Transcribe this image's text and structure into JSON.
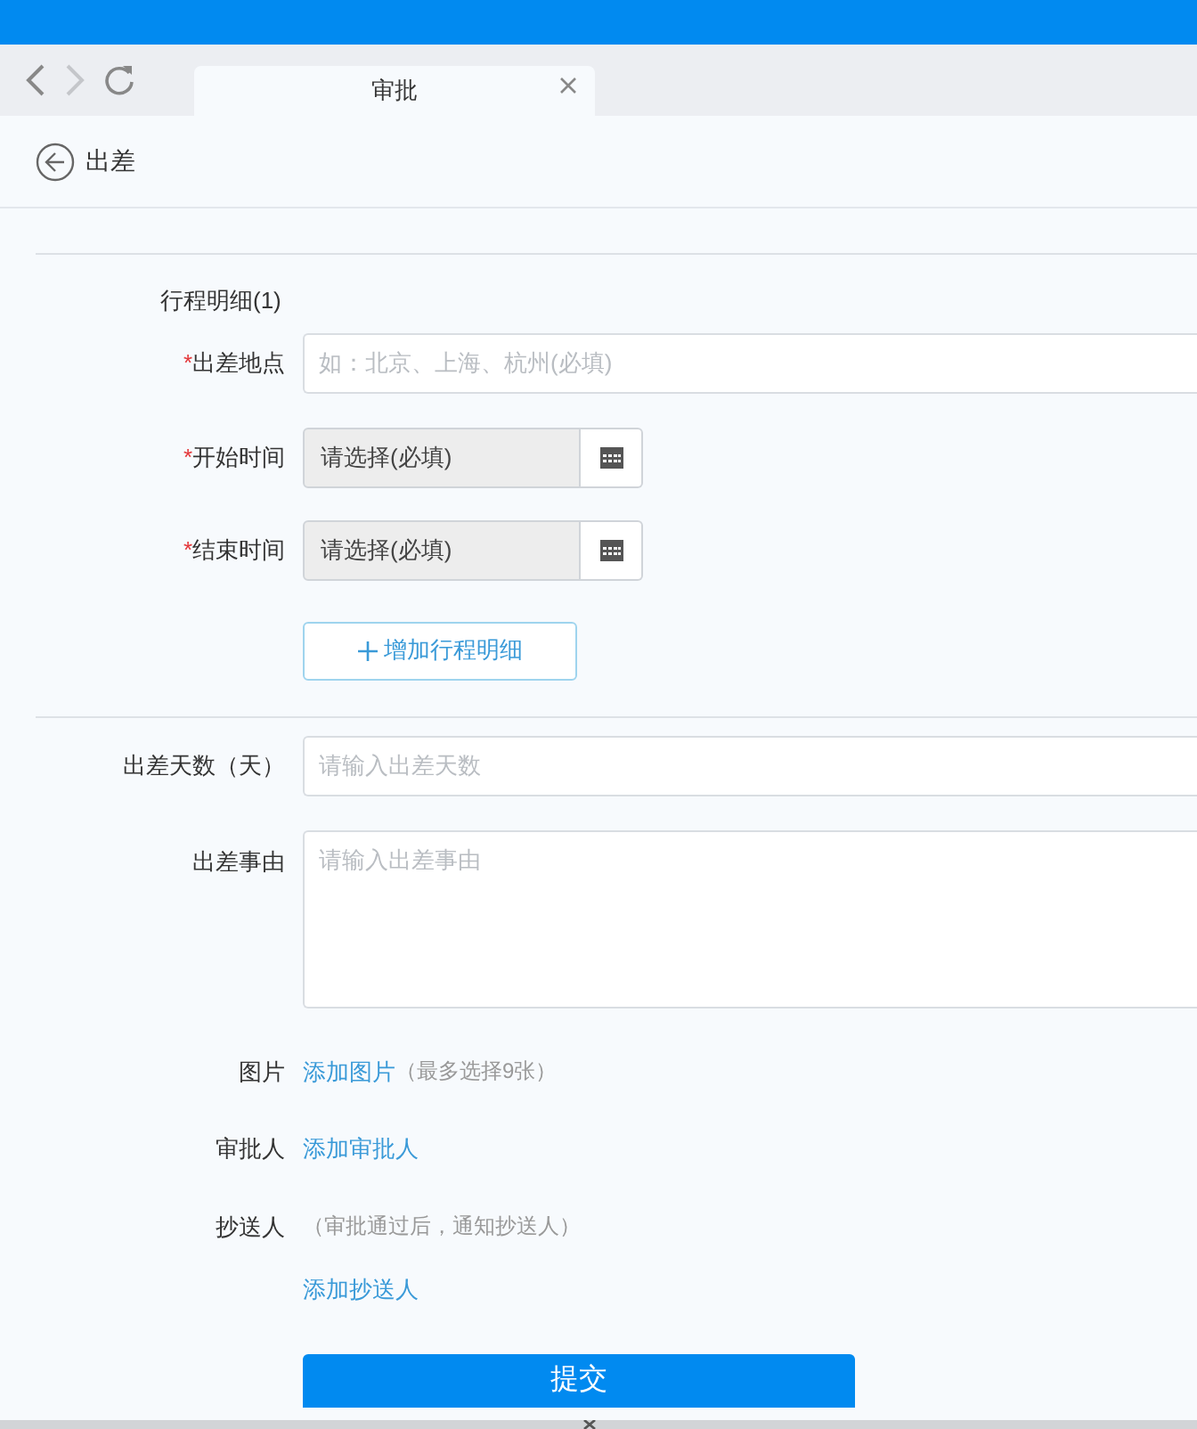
{
  "browser": {
    "tab": {
      "title": "审批",
      "selected": true
    }
  },
  "header": {
    "title": "出差"
  },
  "itinerary": {
    "title": "行程明细(1)",
    "fields": [
      {
        "kind": "text",
        "required_mark": "*",
        "label": "出差地点",
        "placeholder": "如：北京、上海、杭州(必填)"
      },
      {
        "kind": "date",
        "required_mark": "*",
        "label": "开始时间",
        "value": "请选择(必填)"
      },
      {
        "kind": "date",
        "required_mark": "*",
        "label": "结束时间",
        "value": "请选择(必填)"
      }
    ],
    "add_button": "增加行程明细"
  },
  "fields": [
    {
      "kind": "text",
      "label": "出差天数（天）",
      "placeholder": "请输入出差天数"
    },
    {
      "kind": "textarea",
      "label": "出差事由",
      "placeholder": "请输入出差事由"
    },
    {
      "kind": "link",
      "label": "图片",
      "link": "添加图片",
      "note": "（最多选择9张）"
    },
    {
      "kind": "link",
      "label": "审批人",
      "link": "添加审批人"
    },
    {
      "kind": "note_link",
      "label": "抄送人",
      "note": "（审批通过后，通知抄送人）",
      "link": "添加抄送人"
    }
  ],
  "submit": "提交"
}
